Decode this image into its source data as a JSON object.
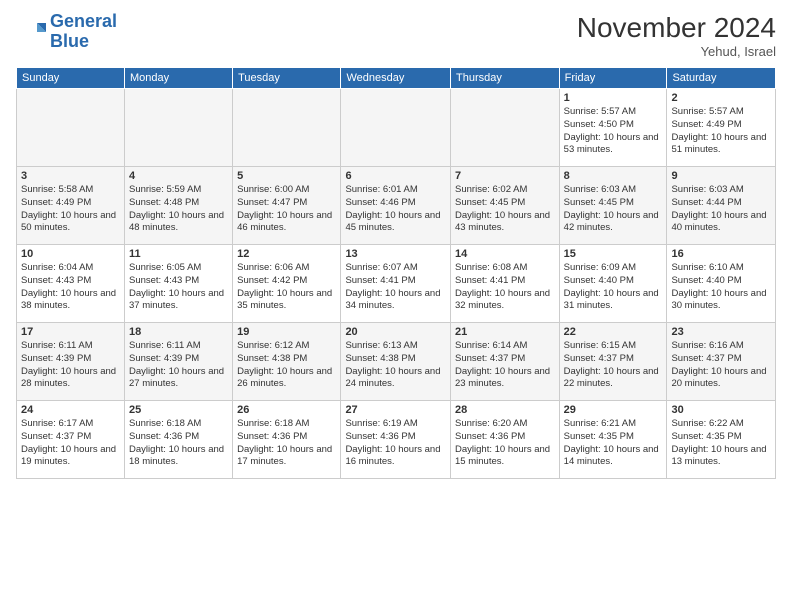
{
  "logo": {
    "line1": "General",
    "line2": "Blue"
  },
  "header": {
    "month": "November 2024",
    "location": "Yehud, Israel"
  },
  "days_of_week": [
    "Sunday",
    "Monday",
    "Tuesday",
    "Wednesday",
    "Thursday",
    "Friday",
    "Saturday"
  ],
  "weeks": [
    [
      {
        "day": "",
        "empty": true
      },
      {
        "day": "",
        "empty": true
      },
      {
        "day": "",
        "empty": true
      },
      {
        "day": "",
        "empty": true
      },
      {
        "day": "",
        "empty": true
      },
      {
        "day": "1",
        "sunrise": "Sunrise: 5:57 AM",
        "sunset": "Sunset: 4:50 PM",
        "daylight": "Daylight: 10 hours and 53 minutes."
      },
      {
        "day": "2",
        "sunrise": "Sunrise: 5:57 AM",
        "sunset": "Sunset: 4:49 PM",
        "daylight": "Daylight: 10 hours and 51 minutes."
      }
    ],
    [
      {
        "day": "3",
        "sunrise": "Sunrise: 5:58 AM",
        "sunset": "Sunset: 4:49 PM",
        "daylight": "Daylight: 10 hours and 50 minutes."
      },
      {
        "day": "4",
        "sunrise": "Sunrise: 5:59 AM",
        "sunset": "Sunset: 4:48 PM",
        "daylight": "Daylight: 10 hours and 48 minutes."
      },
      {
        "day": "5",
        "sunrise": "Sunrise: 6:00 AM",
        "sunset": "Sunset: 4:47 PM",
        "daylight": "Daylight: 10 hours and 46 minutes."
      },
      {
        "day": "6",
        "sunrise": "Sunrise: 6:01 AM",
        "sunset": "Sunset: 4:46 PM",
        "daylight": "Daylight: 10 hours and 45 minutes."
      },
      {
        "day": "7",
        "sunrise": "Sunrise: 6:02 AM",
        "sunset": "Sunset: 4:45 PM",
        "daylight": "Daylight: 10 hours and 43 minutes."
      },
      {
        "day": "8",
        "sunrise": "Sunrise: 6:03 AM",
        "sunset": "Sunset: 4:45 PM",
        "daylight": "Daylight: 10 hours and 42 minutes."
      },
      {
        "day": "9",
        "sunrise": "Sunrise: 6:03 AM",
        "sunset": "Sunset: 4:44 PM",
        "daylight": "Daylight: 10 hours and 40 minutes."
      }
    ],
    [
      {
        "day": "10",
        "sunrise": "Sunrise: 6:04 AM",
        "sunset": "Sunset: 4:43 PM",
        "daylight": "Daylight: 10 hours and 38 minutes."
      },
      {
        "day": "11",
        "sunrise": "Sunrise: 6:05 AM",
        "sunset": "Sunset: 4:43 PM",
        "daylight": "Daylight: 10 hours and 37 minutes."
      },
      {
        "day": "12",
        "sunrise": "Sunrise: 6:06 AM",
        "sunset": "Sunset: 4:42 PM",
        "daylight": "Daylight: 10 hours and 35 minutes."
      },
      {
        "day": "13",
        "sunrise": "Sunrise: 6:07 AM",
        "sunset": "Sunset: 4:41 PM",
        "daylight": "Daylight: 10 hours and 34 minutes."
      },
      {
        "day": "14",
        "sunrise": "Sunrise: 6:08 AM",
        "sunset": "Sunset: 4:41 PM",
        "daylight": "Daylight: 10 hours and 32 minutes."
      },
      {
        "day": "15",
        "sunrise": "Sunrise: 6:09 AM",
        "sunset": "Sunset: 4:40 PM",
        "daylight": "Daylight: 10 hours and 31 minutes."
      },
      {
        "day": "16",
        "sunrise": "Sunrise: 6:10 AM",
        "sunset": "Sunset: 4:40 PM",
        "daylight": "Daylight: 10 hours and 30 minutes."
      }
    ],
    [
      {
        "day": "17",
        "sunrise": "Sunrise: 6:11 AM",
        "sunset": "Sunset: 4:39 PM",
        "daylight": "Daylight: 10 hours and 28 minutes."
      },
      {
        "day": "18",
        "sunrise": "Sunrise: 6:11 AM",
        "sunset": "Sunset: 4:39 PM",
        "daylight": "Daylight: 10 hours and 27 minutes."
      },
      {
        "day": "19",
        "sunrise": "Sunrise: 6:12 AM",
        "sunset": "Sunset: 4:38 PM",
        "daylight": "Daylight: 10 hours and 26 minutes."
      },
      {
        "day": "20",
        "sunrise": "Sunrise: 6:13 AM",
        "sunset": "Sunset: 4:38 PM",
        "daylight": "Daylight: 10 hours and 24 minutes."
      },
      {
        "day": "21",
        "sunrise": "Sunrise: 6:14 AM",
        "sunset": "Sunset: 4:37 PM",
        "daylight": "Daylight: 10 hours and 23 minutes."
      },
      {
        "day": "22",
        "sunrise": "Sunrise: 6:15 AM",
        "sunset": "Sunset: 4:37 PM",
        "daylight": "Daylight: 10 hours and 22 minutes."
      },
      {
        "day": "23",
        "sunrise": "Sunrise: 6:16 AM",
        "sunset": "Sunset: 4:37 PM",
        "daylight": "Daylight: 10 hours and 20 minutes."
      }
    ],
    [
      {
        "day": "24",
        "sunrise": "Sunrise: 6:17 AM",
        "sunset": "Sunset: 4:37 PM",
        "daylight": "Daylight: 10 hours and 19 minutes."
      },
      {
        "day": "25",
        "sunrise": "Sunrise: 6:18 AM",
        "sunset": "Sunset: 4:36 PM",
        "daylight": "Daylight: 10 hours and 18 minutes."
      },
      {
        "day": "26",
        "sunrise": "Sunrise: 6:18 AM",
        "sunset": "Sunset: 4:36 PM",
        "daylight": "Daylight: 10 hours and 17 minutes."
      },
      {
        "day": "27",
        "sunrise": "Sunrise: 6:19 AM",
        "sunset": "Sunset: 4:36 PM",
        "daylight": "Daylight: 10 hours and 16 minutes."
      },
      {
        "day": "28",
        "sunrise": "Sunrise: 6:20 AM",
        "sunset": "Sunset: 4:36 PM",
        "daylight": "Daylight: 10 hours and 15 minutes."
      },
      {
        "day": "29",
        "sunrise": "Sunrise: 6:21 AM",
        "sunset": "Sunset: 4:35 PM",
        "daylight": "Daylight: 10 hours and 14 minutes."
      },
      {
        "day": "30",
        "sunrise": "Sunrise: 6:22 AM",
        "sunset": "Sunset: 4:35 PM",
        "daylight": "Daylight: 10 hours and 13 minutes."
      }
    ]
  ]
}
